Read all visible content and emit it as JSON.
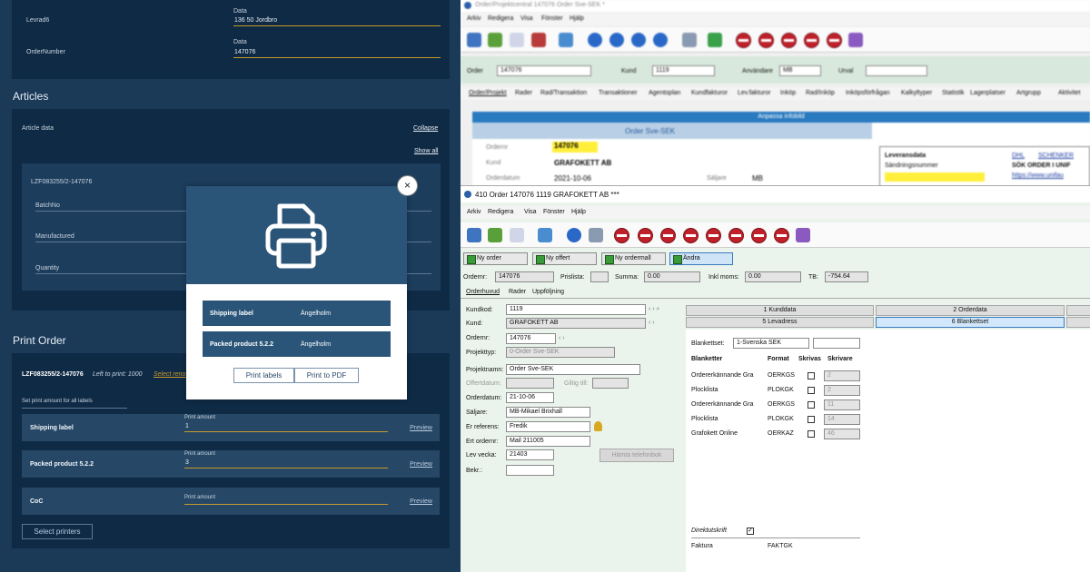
{
  "left_panel": {
    "fields": [
      {
        "label": "Levrad6",
        "field_label": "Data",
        "value": "136 50  Jordbro"
      },
      {
        "label": "OrderNumber",
        "field_label": "Data",
        "value": "147076"
      }
    ],
    "articles": {
      "heading": "Articles",
      "card_title": "Article data",
      "collapse": "Collapse",
      "show_all": "Show all",
      "item_id": "LZF083255/2-147076",
      "props": [
        "BatchNo",
        "Manufactured",
        "Quantity"
      ]
    },
    "print_order": {
      "heading": "Print Order",
      "order_id": "LZF083255/2-147076",
      "left_to_print": "Left to print: 1000",
      "select_link": "Select reno",
      "set_amount": "Set print amount for all labels",
      "amount_label": "Print amount",
      "preview": "Preview",
      "rows": [
        {
          "name": "Shipping label",
          "amount": "1"
        },
        {
          "name": "Packed product 5.2.2",
          "amount": "3"
        },
        {
          "name": "CoC",
          "amount": ""
        }
      ],
      "select_printers": "Select printers"
    },
    "modal": {
      "items": [
        {
          "name": "Shipping label",
          "location": "Ängelholm"
        },
        {
          "name": "Packed product 5.2.2",
          "location": "Ängelholm"
        }
      ],
      "print_labels": "Print labels",
      "print_pdf": "Print to PDF",
      "close": "×"
    }
  },
  "back_window": {
    "title": "Order/Projektcentral 147076 Order Sve-SEK *",
    "menu": [
      "Arkiv",
      "Redigera",
      "Visa",
      "Fönster",
      "Hjälp"
    ],
    "order_label": "Order",
    "order_value": "147076",
    "kund_label": "Kund",
    "kund_value": "1119",
    "anvandare_label": "Användare",
    "anvandare_value": "MB",
    "urval_label": "Urval",
    "tabs": [
      "Order/Projekt",
      "Rader",
      "Rad/Transaktion",
      "Transaktioner",
      "Agentoplan",
      "Kundfakturor",
      "Lev.fakturor",
      "Inköp",
      "Rad/Inköp",
      "Inköpsförfrågan",
      "Kalkyltyper",
      "Statistik",
      "Lagerplatser",
      "Artgrupp",
      "Aktivitet"
    ],
    "banner": "Anpassa infobild",
    "subtitle": "Order Sve-SEK",
    "info_labels": [
      "Ordernr",
      "Kund",
      "Orderdatum",
      "Säljare"
    ],
    "info_values": [
      "147076",
      "GRAFOKETT AB",
      "2021-10-06",
      "MB"
    ],
    "lev_title": "Leveransdata",
    "sand_label": "Sändningsnummer",
    "lev_links": [
      "DHL",
      "SCHENKER",
      "SÖK ORDER I UNIF",
      "https://www.unifau"
    ]
  },
  "front_window": {
    "title": "410 Order  147076 1119 GRAFOKETT AB ***",
    "menu": [
      "Arkiv",
      "Redigera",
      "Visa",
      "Fönster",
      "Hjälp"
    ],
    "buttons": [
      "Ny order",
      "Ny offert",
      "Ny ordermall",
      "Ändra"
    ],
    "ordernr_label": "Ordernr:",
    "ordernr_value": "147076",
    "prislista_label": "Prislista:",
    "summa_label": "Summa:",
    "summa_value": "0.00",
    "inklmoms_label": "Inkl moms:",
    "inklmoms_value": "0.00",
    "tb_label": "TB:",
    "tb_value": "-754.64",
    "tabs": [
      "Orderhuvud",
      "Rader",
      "Uppföljning"
    ],
    "form": {
      "kundkod_label": "Kundkod:",
      "kundkod": "1119",
      "kund_label": "Kund:",
      "kund": "GRAFOKETT AB",
      "ordernr_label": "Ordernr:",
      "ordernr": "147076",
      "projekttyp_label": "Projekttyp:",
      "projekttyp": "0-Order Sve-SEK",
      "projektnamn_label": "Projektnamn:",
      "projektnamn": "Order Sve-SEK",
      "offertdatum_label": "Offertdatum:",
      "giltig_label": "Giltig till:",
      "orderdatum_label": "Orderdatum:",
      "orderdatum": "21-10-06",
      "saljare_label": "Säljare:",
      "saljare": "MB-Mikael Brixhall",
      "erref_label": "Er referens:",
      "erref": "Fredik",
      "erordernr_label": "Ert ordernr:",
      "erordernr": "Mail 211005",
      "levvecka_label": "Lev vecka:",
      "levvecka": "21403",
      "bekr_label": "Bekr.:",
      "hamta_btn": "Hämta telefonbok"
    },
    "right_tabs_row1": [
      "1 Kunddata",
      "2 Orderdata"
    ],
    "right_tabs_row2": [
      "5 Levadress",
      "6 Blankettset"
    ],
    "blankettset_label": "Blankettset:",
    "blankettset_value": "1-Svenska SEK",
    "table_headers": [
      "Blanketter",
      "Format",
      "Skrivas",
      "Skrivare"
    ],
    "table_rows": [
      {
        "name": "Ordererkännande Gra",
        "format": "OERKGS",
        "printer": "2"
      },
      {
        "name": "Plocklista",
        "format": "PLOKGK",
        "printer": "2"
      },
      {
        "name": "Ordererkännande Gra",
        "format": "OERKGS",
        "printer": "11"
      },
      {
        "name": "Plocklista",
        "format": "PLOKGK",
        "printer": "14"
      },
      {
        "name": "Grafokett Online",
        "format": "OERKAZ",
        "printer": "46"
      }
    ],
    "direktutskrift_label": "Direktutskrift",
    "faktura_label": "Faktura",
    "faktura_value": "FAKTGK"
  },
  "colors": {
    "left_bg": "#1b3a58",
    "card_bg": "#0f2a45",
    "accent_line": "#c89a2c",
    "modal_header": "#2a5578",
    "highlight": "#ffef3a",
    "badge_red": "#c0202a"
  }
}
